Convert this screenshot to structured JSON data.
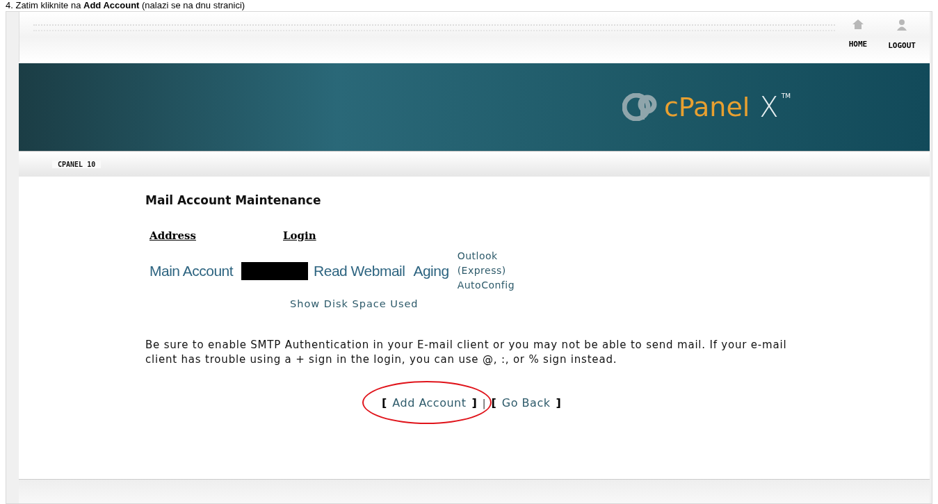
{
  "caption": "4. Zatim kliknite na **Add Account** (nalazi se na dnu stranici)",
  "header": {
    "nav": [
      {
        "kind": "home",
        "label": "HOME"
      },
      {
        "kind": "logout",
        "label": "LOGOUT"
      }
    ]
  },
  "banner": {
    "logo": "cPanel",
    "mark": "X",
    "tm": "TM"
  },
  "section_label": "CPANEL 10",
  "page": {
    "title": "Mail Account Maintenance",
    "columns": [
      "Address",
      "Login"
    ],
    "row": {
      "address": "Main Account",
      "login_redacted": true,
      "links": [
        "Read Webmail",
        "Aging"
      ],
      "config_link": [
        "Outlook",
        "(Express)",
        "AutoConfig"
      ]
    },
    "disk_link": "Show Disk Space Used",
    "note": "Be sure to enable SMTP Authentication in your E-mail client or you may not be able to send mail. If your e-mail client has trouble using a + sign in the login, you can use @, :, or % sign instead.",
    "actions": [
      {
        "open": "[",
        "label": "Add Account",
        "close": "]",
        "circled": true
      },
      {
        "open": "[",
        "label": "Go Back",
        "close": "]",
        "circled": false
      }
    ],
    "separator": "|"
  }
}
